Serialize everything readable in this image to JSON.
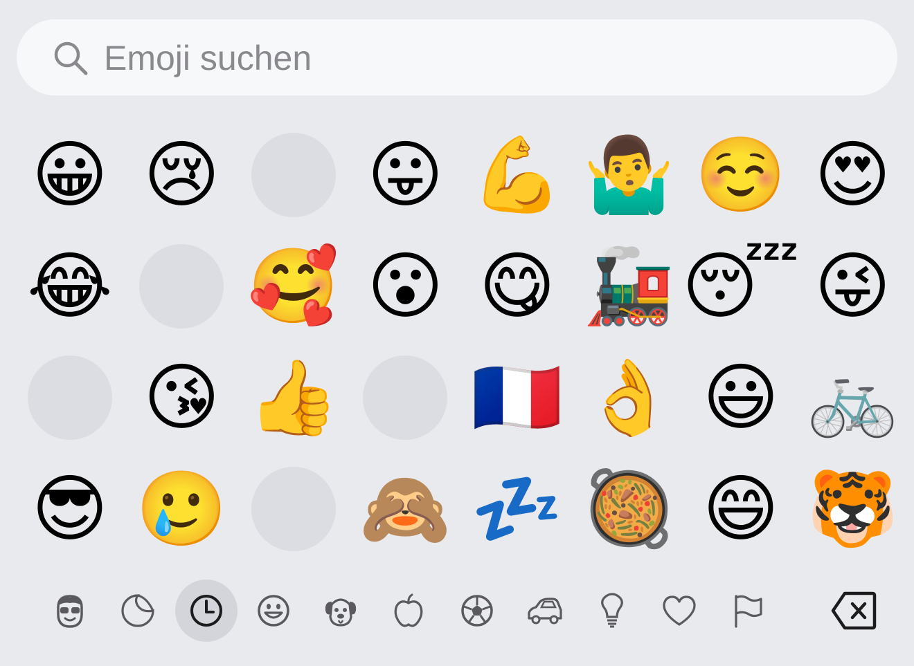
{
  "search": {
    "placeholder": "Emoji suchen",
    "value": ""
  },
  "emoji_grid": [
    [
      "😀",
      "😢",
      "",
      "😛",
      "💪",
      "🤷‍♂️",
      "☺️",
      "😍"
    ],
    [
      "😂",
      "",
      "🥰",
      "😮",
      "😋",
      "🚂",
      "😴",
      "😜"
    ],
    [
      "",
      "😘",
      "👍",
      "",
      "🇫🇷",
      "👌",
      "😃",
      "🚲"
    ],
    [
      "😎",
      "🥲",
      "",
      "🙈",
      "💤",
      "🥘",
      "😄",
      "🐯"
    ]
  ],
  "categories": [
    {
      "name": "memoji-icon",
      "selected": false
    },
    {
      "name": "sticker-icon",
      "selected": false
    },
    {
      "name": "recent-clock-icon",
      "selected": true
    },
    {
      "name": "smiley-icon",
      "selected": false
    },
    {
      "name": "animal-icon",
      "selected": false
    },
    {
      "name": "food-apple-icon",
      "selected": false
    },
    {
      "name": "soccer-ball-icon",
      "selected": false
    },
    {
      "name": "car-icon",
      "selected": false
    },
    {
      "name": "lightbulb-icon",
      "selected": false
    },
    {
      "name": "heart-icon",
      "selected": false
    },
    {
      "name": "flag-icon",
      "selected": false
    }
  ],
  "colors": {
    "background": "#e9eaee",
    "search_bg": "#f7f8fa",
    "placeholder": "#8a8a8e",
    "placeholder_circle": "#dcdde2",
    "selected_tab": "#d4d5da"
  }
}
